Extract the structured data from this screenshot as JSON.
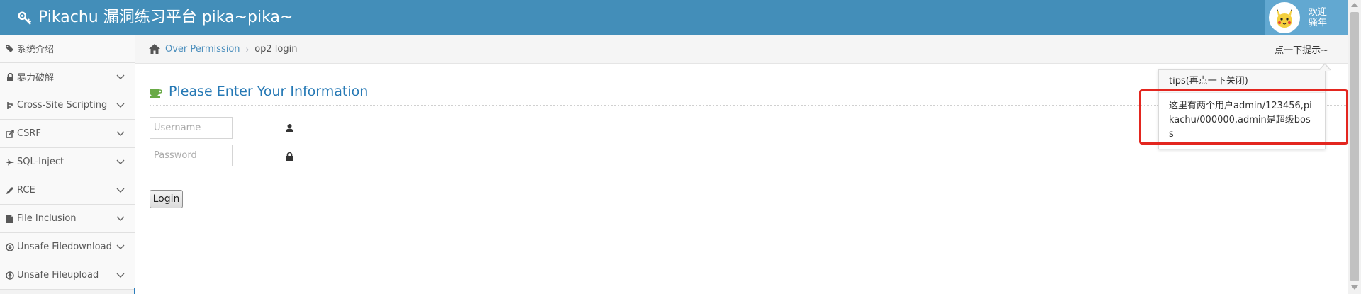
{
  "navbar": {
    "brand_title": "Pikachu 漏洞练习平台 pika~pika~",
    "welcome_line1": "欢迎",
    "welcome_line2": "骚年"
  },
  "sidebar": {
    "items": [
      {
        "label": "系统介绍",
        "icon": "tags-icon",
        "expandable": false
      },
      {
        "label": "暴力破解",
        "icon": "lock-icon",
        "expandable": true
      },
      {
        "label": "Cross-Site Scripting",
        "icon": "code-fork-icon",
        "expandable": true
      },
      {
        "label": "CSRF",
        "icon": "share-icon",
        "expandable": true
      },
      {
        "label": "SQL-Inject",
        "icon": "fighter-jet-icon",
        "expandable": true
      },
      {
        "label": "RCE",
        "icon": "pencil-icon",
        "expandable": true
      },
      {
        "label": "File Inclusion",
        "icon": "file-icon",
        "expandable": true
      },
      {
        "label": "Unsafe Filedownload",
        "icon": "download-icon",
        "expandable": true
      },
      {
        "label": "Unsafe Fileupload",
        "icon": "upload-icon",
        "expandable": true
      }
    ]
  },
  "breadcrumbs": {
    "parent": "Over Permission",
    "separator": "›",
    "current": "op2 login",
    "tips_link": "点一下提示~"
  },
  "page": {
    "header": "Please Enter Your Information",
    "username_placeholder": "Username",
    "password_placeholder": "Password",
    "login_button": "Login"
  },
  "popover": {
    "title": "tips(再点一下关闭)",
    "body": "这里有两个用户admin/123456,pikachu/000000,admin是超级boss"
  },
  "colors": {
    "navbar": "#438eb9",
    "accent_blue": "#2679b5",
    "highlight_red": "#e3261f"
  }
}
